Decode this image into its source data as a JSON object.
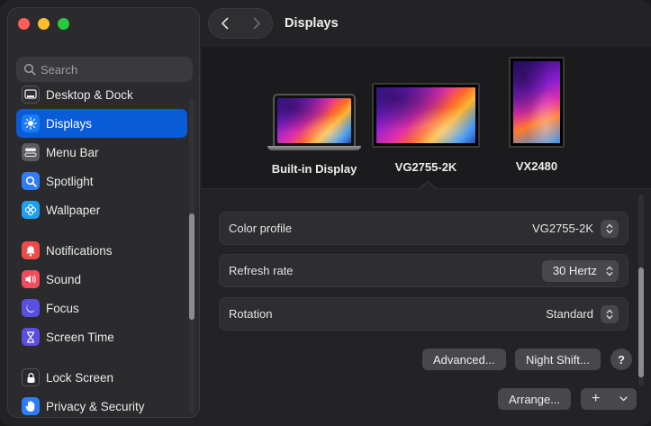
{
  "window": {
    "title": "Displays"
  },
  "sidebar": {
    "search_placeholder": "Search",
    "items": [
      {
        "label": "Desktop & Dock",
        "icon": "desktop-dock-icon",
        "color": "#2f2f33"
      },
      {
        "label": "Displays",
        "icon": "sun-icon",
        "color": "#1a7cf5",
        "active": true
      },
      {
        "label": "Menu Bar",
        "icon": "menubar-icon",
        "color": "#5b5b60"
      },
      {
        "label": "Spotlight",
        "icon": "magnifier-icon",
        "color": "#2f7cf6"
      },
      {
        "label": "Wallpaper",
        "icon": "flower-icon",
        "color": "#1e9ff0"
      },
      {
        "label": "Notifications",
        "icon": "bell-icon",
        "color": "#f04b4b"
      },
      {
        "label": "Sound",
        "icon": "speaker-icon",
        "color": "#f04b5e"
      },
      {
        "label": "Focus",
        "icon": "moon-icon",
        "color": "#5a4fe0"
      },
      {
        "label": "Screen Time",
        "icon": "hourglass-icon",
        "color": "#5a4fe0"
      },
      {
        "label": "Lock Screen",
        "icon": "lock-icon",
        "color": "#2b2b2f"
      },
      {
        "label": "Privacy & Security",
        "icon": "hand-icon",
        "color": "#2e7cf6"
      }
    ]
  },
  "displays": [
    {
      "name": "Built-in Display"
    },
    {
      "name": "VG2755-2K",
      "selected": true
    },
    {
      "name": "VX2480"
    }
  ],
  "settings": {
    "color_profile": {
      "label": "Color profile",
      "value": "VG2755-2K"
    },
    "refresh_rate": {
      "label": "Refresh rate",
      "value": "30 Hertz"
    },
    "rotation": {
      "label": "Rotation",
      "value": "Standard"
    }
  },
  "buttons": {
    "advanced": "Advanced...",
    "night_shift": "Night Shift...",
    "help": "?",
    "arrange": "Arrange...",
    "add": "+"
  },
  "colors": {
    "accent": "#0a5bd6"
  }
}
